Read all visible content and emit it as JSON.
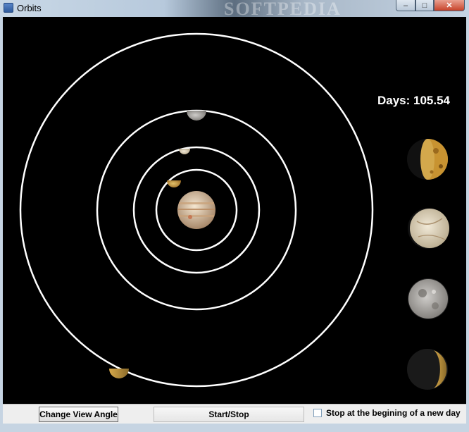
{
  "window": {
    "title": "Orbits",
    "watermark": "SOFTPEDIA",
    "controls": {
      "minimize": "–",
      "maximize": "□",
      "close": "✕"
    }
  },
  "sim": {
    "days_text": "Days: 105.54",
    "planet": "Jupiter",
    "moons": [
      "Io",
      "Europa",
      "Ganymede",
      "Callisto"
    ],
    "colors": {
      "background": "#000000",
      "orbit": "#ffffff",
      "io": "#c89a3a",
      "europa": "#d9cfb8",
      "ganymede": "#a9a7a4",
      "callisto": "#3a3a3a"
    }
  },
  "controls": {
    "change_view_label": "Change View Angle",
    "start_stop_label": "Start/Stop",
    "stop_checkbox_label": "Stop at the begining of a new day",
    "stop_checkbox_checked": false
  }
}
